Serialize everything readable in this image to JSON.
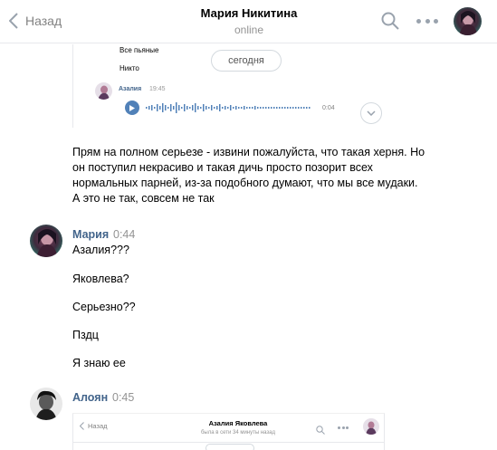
{
  "header": {
    "back_label": "Назад",
    "title": "Мария Никитина",
    "status": "online"
  },
  "embed_top": {
    "line_1": "Все пьяные",
    "line_2": "Никто",
    "date_pill": "сегодня",
    "sender": "Азалия",
    "time": "19:45",
    "duration": "0:04"
  },
  "messages": {
    "paragraph": "Прям на полном серьезе - извини пожалуйста, что такая херня. Но он поступил некрасиво и такая дичь просто позорит всех нормальных парней, из-за подобного думают, что мы все мудаки. А это не так, совсем не так",
    "maria": {
      "name": "Мария",
      "time": "0:44",
      "lines": [
        "Азалия???",
        "Яковлева?",
        "Серьезно??",
        "Пздц",
        "Я знаю ее"
      ]
    },
    "aloyan": {
      "name": "Алоян",
      "time": "0:45"
    }
  },
  "embed_bottom": {
    "back_label": "Назад",
    "title": "Азалия Яковлева",
    "status": "была в сети 34 минуты назад"
  }
}
